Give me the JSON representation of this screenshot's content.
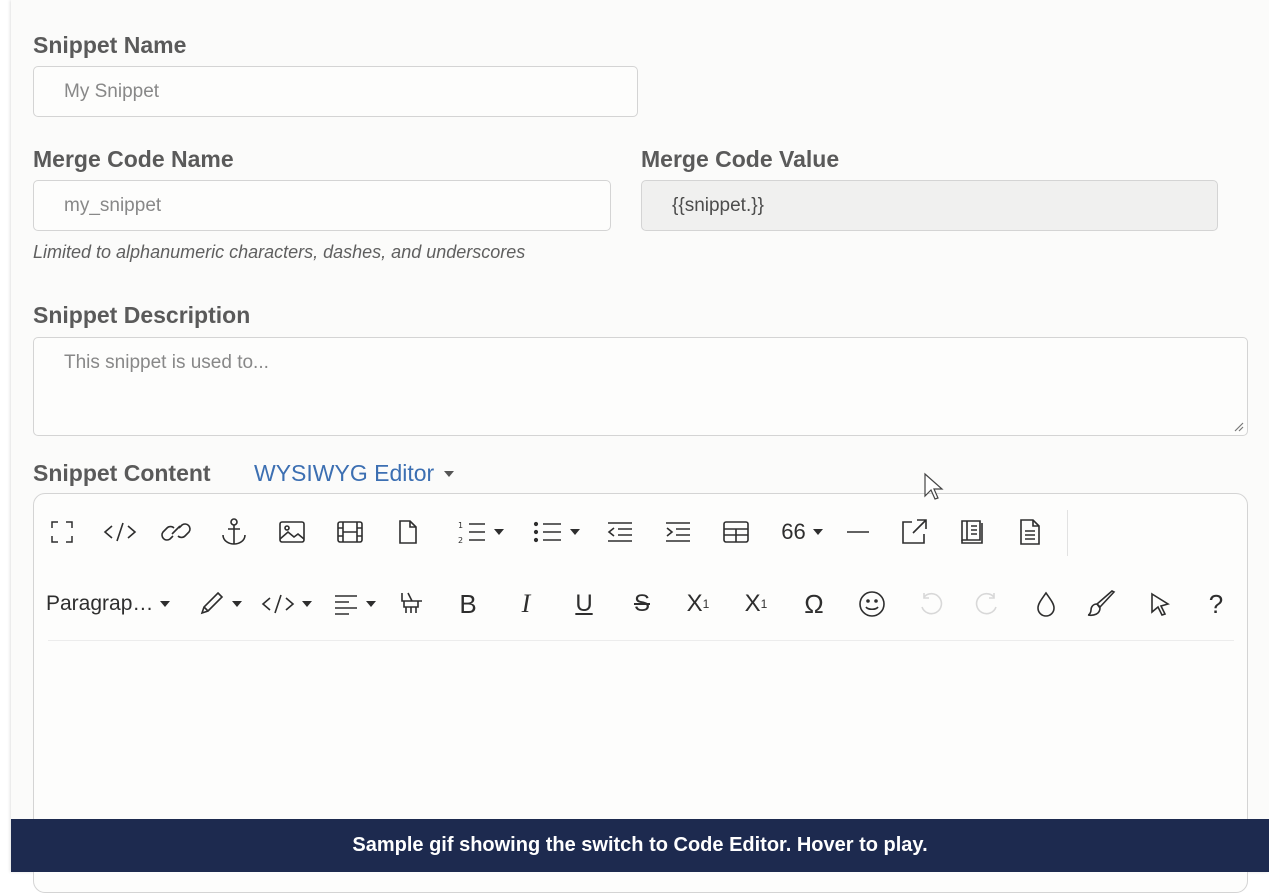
{
  "form": {
    "snippet_name": {
      "label": "Snippet Name",
      "placeholder": "My Snippet"
    },
    "merge_code_name": {
      "label": "Merge Code Name",
      "placeholder": "my_snippet",
      "hint": "Limited to alphanumeric characters, dashes, and underscores"
    },
    "merge_code_value": {
      "label": "Merge Code Value",
      "value": "{{snippet.}}"
    },
    "snippet_description": {
      "label": "Snippet Description",
      "placeholder": "This snippet is used to..."
    },
    "snippet_content": {
      "label": "Snippet Content",
      "editor_mode": "WYSIWYG Editor"
    }
  },
  "toolbar": {
    "row1": [
      "fullscreen-icon",
      "code-view-icon",
      "link-icon",
      "anchor-icon",
      "image-icon",
      "video-icon",
      "page-icon",
      "ordered-list-icon",
      "unordered-list-icon",
      "outdent-icon",
      "indent-icon",
      "table-icon",
      "blockquote-icon",
      "horizontal-rule-icon",
      "external-link-icon",
      "book-icon",
      "document-icon"
    ],
    "blockquote_label": "66",
    "paragraph_label": "Paragrap…",
    "undo_state": "disabled",
    "redo_state": "disabled"
  },
  "banner": {
    "text": "Sample gif showing the switch to Code Editor. Hover to play."
  },
  "colors": {
    "accent": "#3c6fb2",
    "banner_bg": "#1d2a4f"
  }
}
